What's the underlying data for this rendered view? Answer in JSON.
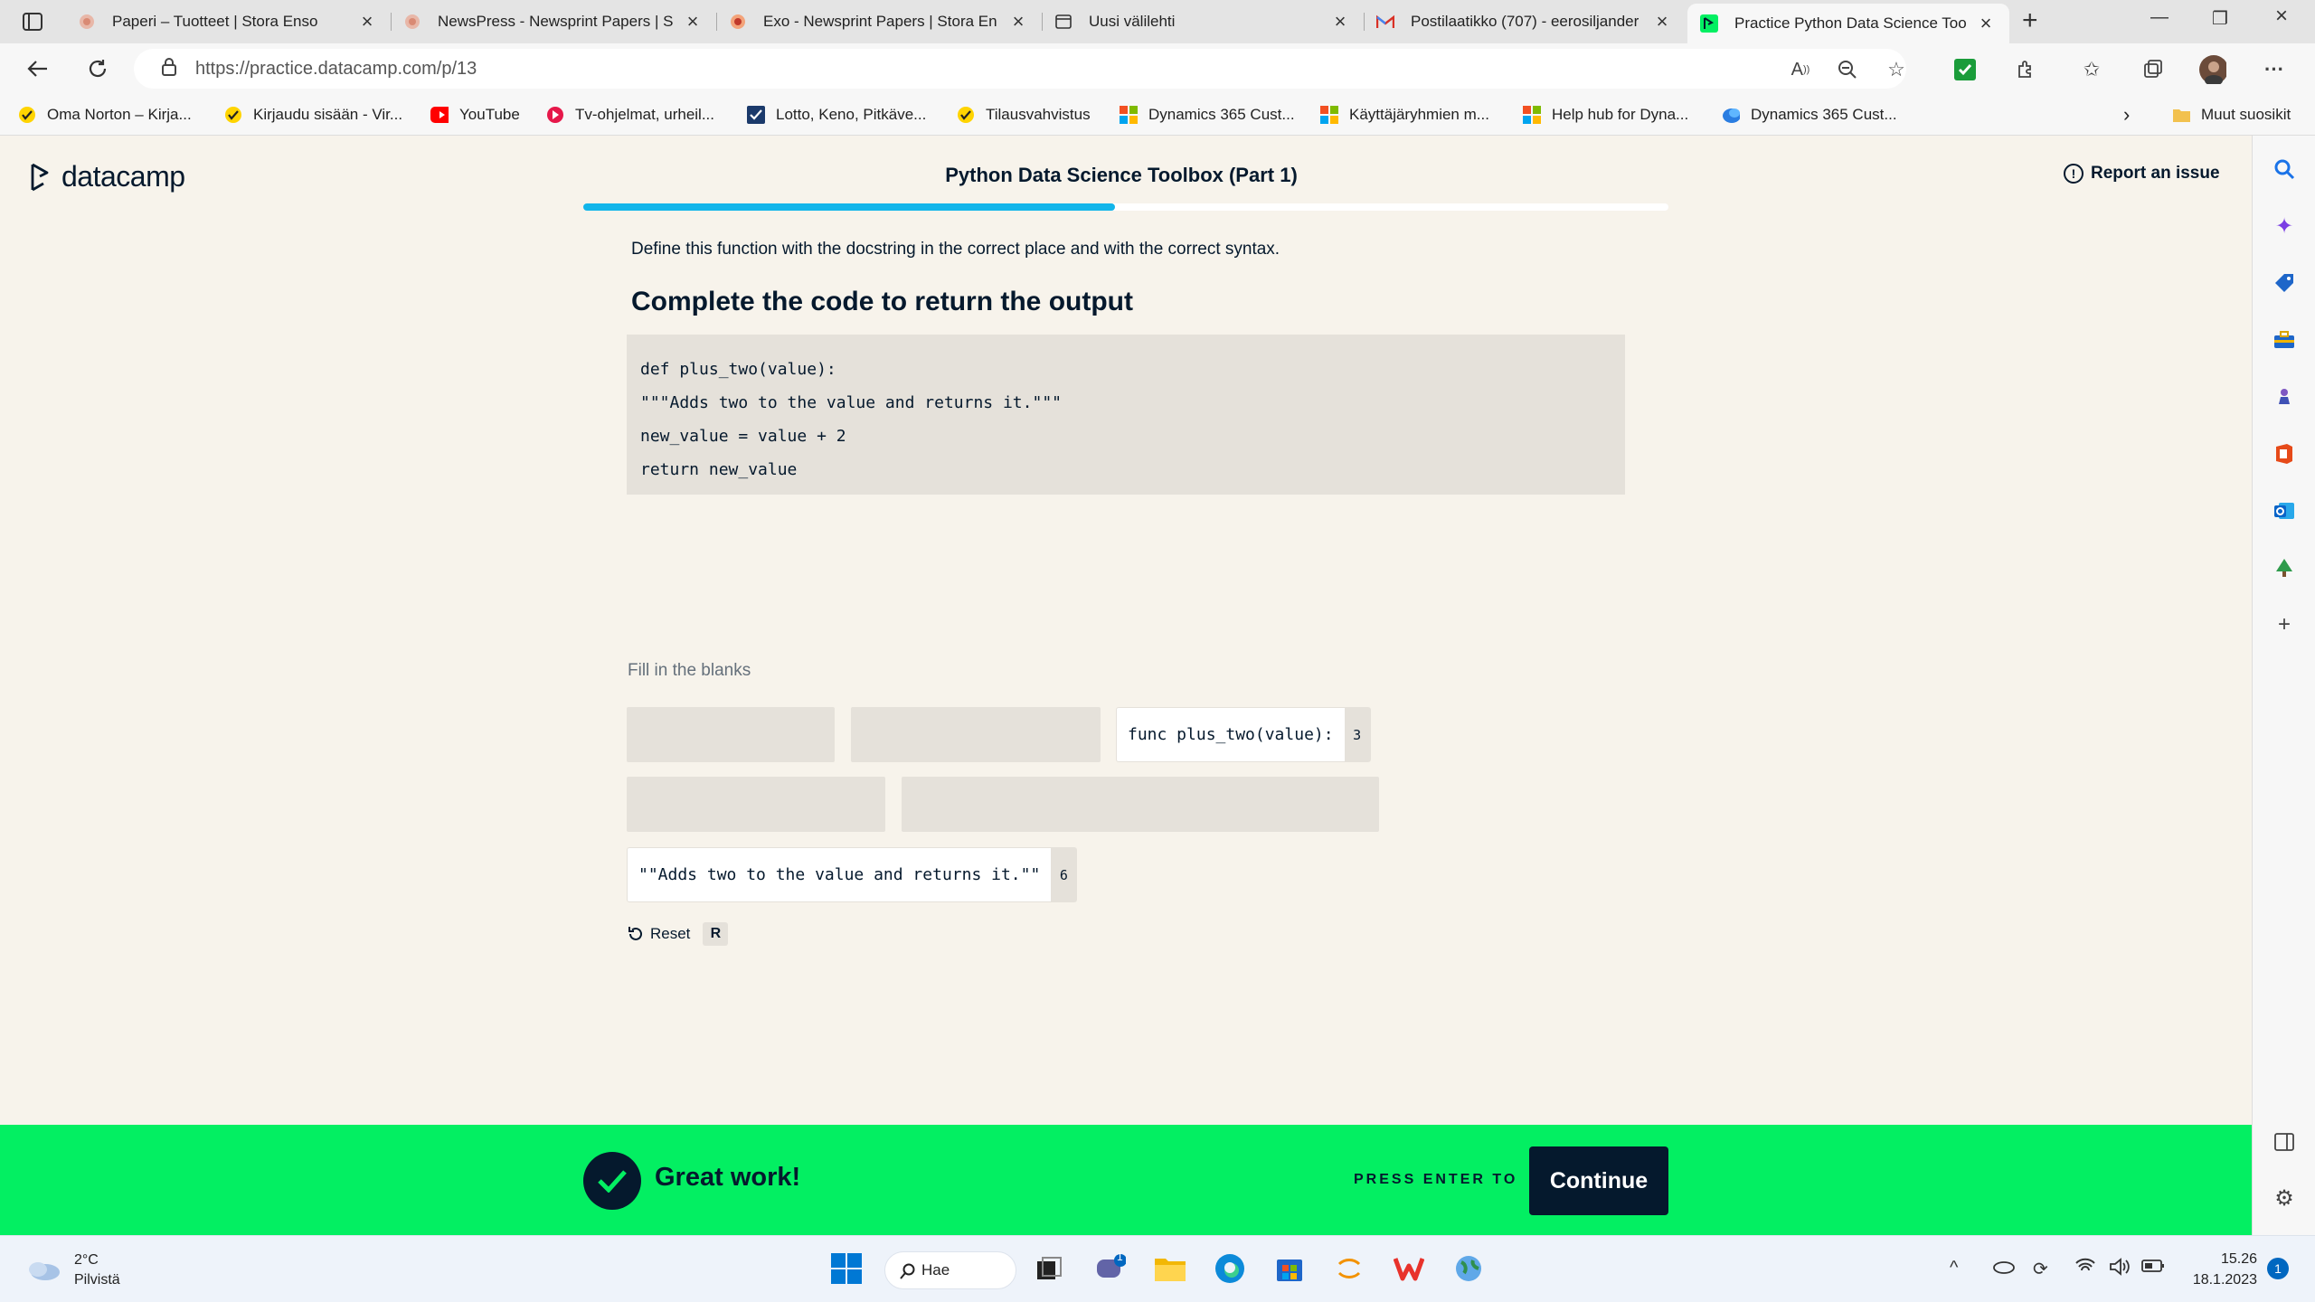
{
  "browser": {
    "tabs": [
      {
        "title": "Paperi – Tuotteet | Stora Enso"
      },
      {
        "title": "NewsPress - Newsprint Papers | S"
      },
      {
        "title": "Exo - Newsprint Papers | Stora En"
      },
      {
        "title": "Uusi välilehti"
      },
      {
        "title": "Postilaatikko (707) - eerosiljander"
      },
      {
        "title": "Practice Python Data Science Too"
      }
    ],
    "url": "https://practice.datacamp.com/p/13",
    "bookmarks": [
      "Oma Norton – Kirja...",
      "Kirjaudu sisään - Vir...",
      "YouTube",
      "Tv-ohjelmat, urheil...",
      "Lotto, Keno, Pitkäve...",
      "Tilausvahvistus",
      "Dynamics 365 Cust...",
      "Käyttäjäryhmien m...",
      "Help hub for Dyna...",
      "Dynamics 365 Cust..."
    ],
    "other_favorites": "Muut suosikit"
  },
  "page": {
    "logo": "datacamp",
    "course_title": "Python Data Science Toolbox (Part 1)",
    "report": "Report an issue",
    "progress": 0.49,
    "instruction": "Define this function with the docstring in the correct place and with the correct syntax.",
    "task_title": "Complete the code to return the output",
    "code_lines": [
      "def plus_two(value):",
      "\"\"\"Adds two to the value and returns it.\"\"\"",
      "new_value = value + 2",
      "return new_value"
    ],
    "fill_label": "Fill in the blanks",
    "chips": [
      {
        "text": "func plus_two(value):",
        "key": "3"
      },
      {
        "text": "\"\"Adds two to the value and returns it.\"\"",
        "key": "6"
      }
    ],
    "reset_label": "Reset",
    "reset_key": "R"
  },
  "feedback": {
    "message": "Great work!",
    "hint": "PRESS ENTER TO",
    "button": "Continue"
  },
  "taskbar": {
    "temperature": "2°C",
    "condition": "Pilvistä",
    "search": "Hae",
    "time": "15.26",
    "date": "18.1.2023",
    "notifications": "1",
    "chat_badge": "1"
  },
  "colors": {
    "brand_green": "#03ef62",
    "navy": "#05192d",
    "progress_blue": "#12b5ea",
    "page_bg": "#f7f3eb"
  }
}
